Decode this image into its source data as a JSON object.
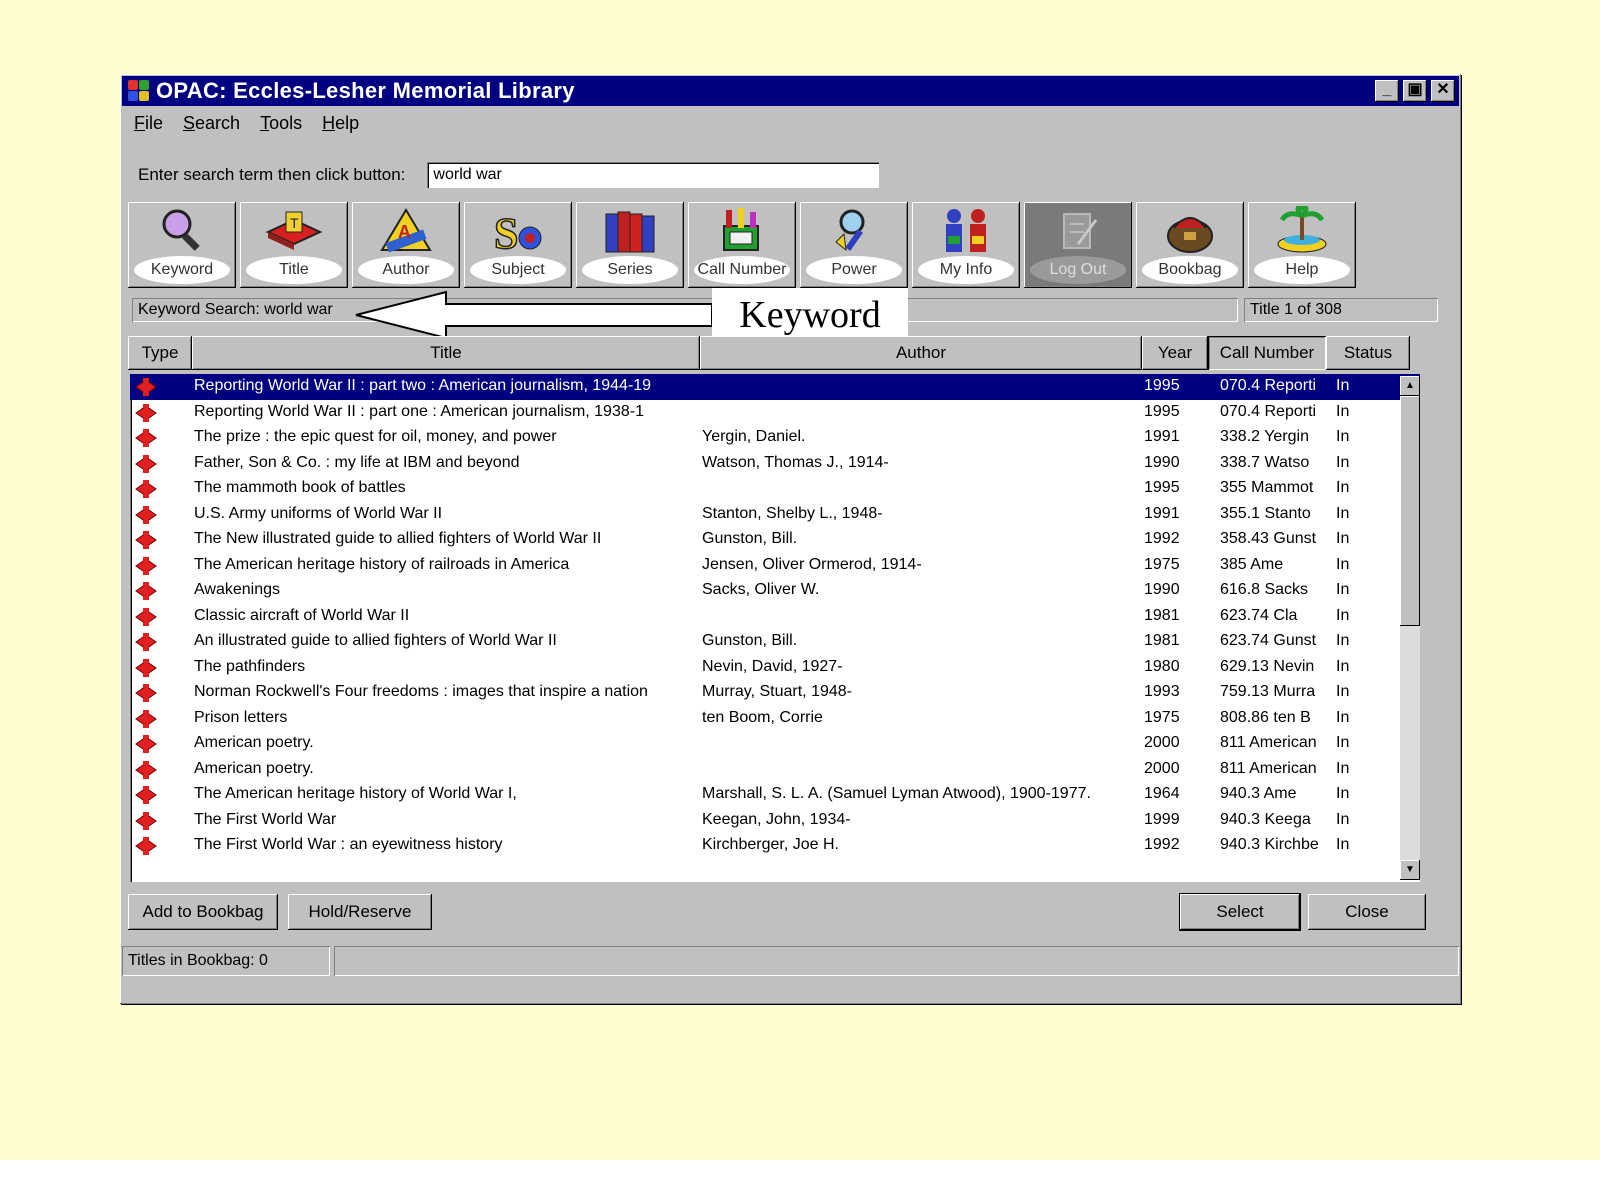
{
  "window": {
    "title": "OPAC: Eccles-Lesher Memorial Library",
    "controls": {
      "minimize": "_",
      "maximize": "▣",
      "close": "✕"
    }
  },
  "menu": [
    {
      "label": "File",
      "accel": "F",
      "rest": "ile"
    },
    {
      "label": "Search",
      "accel": "S",
      "rest": "earch"
    },
    {
      "label": "Tools",
      "accel": "T",
      "rest": "ools"
    },
    {
      "label": "Help",
      "accel": "H",
      "rest": "elp"
    }
  ],
  "search": {
    "label": "Enter search term then click button:",
    "value": "world war"
  },
  "toolbar": [
    {
      "label": "Keyword",
      "icon": "magnifier-icon"
    },
    {
      "label": "Title",
      "icon": "book-icon"
    },
    {
      "label": "Author",
      "icon": "author-icon"
    },
    {
      "label": "Subject",
      "icon": "subject-icon"
    },
    {
      "label": "Series",
      "icon": "series-books-icon"
    },
    {
      "label": "Call Number",
      "icon": "call-number-icon"
    },
    {
      "label": "Power",
      "icon": "power-search-icon"
    },
    {
      "label": "My Info",
      "icon": "people-icon"
    },
    {
      "label": "Log Out",
      "icon": "log-out-icon",
      "disabled": true
    },
    {
      "label": "Bookbag",
      "icon": "bookbag-icon"
    },
    {
      "label": "Help",
      "icon": "help-island-icon"
    }
  ],
  "status_line": "Keyword Search: world war",
  "title_count": "Title 1 of 308",
  "callout": "Keyword",
  "columns": {
    "type": "Type",
    "title": "Title",
    "author": "Author",
    "year": "Year",
    "call_number": "Call Number",
    "status": "Status"
  },
  "rows": [
    {
      "title": "Reporting World War II : part two : American journalism, 1944-19",
      "author": "",
      "year": "1995",
      "call": "070.4 Reporti",
      "status": "In",
      "selected": true
    },
    {
      "title": "Reporting World War II : part one : American journalism, 1938-1",
      "author": "",
      "year": "1995",
      "call": "070.4 Reporti",
      "status": "In"
    },
    {
      "title": "The prize : the epic quest for oil, money, and power",
      "author": "Yergin, Daniel.",
      "year": "1991",
      "call": "338.2 Yergin",
      "status": "In"
    },
    {
      "title": "Father, Son & Co. : my life at IBM and beyond",
      "author": "Watson, Thomas J., 1914-",
      "year": "1990",
      "call": "338.7 Watso",
      "status": "In"
    },
    {
      "title": "The mammoth book of battles",
      "author": "",
      "year": "1995",
      "call": "355 Mammot",
      "status": "In"
    },
    {
      "title": "U.S. Army uniforms of World War II",
      "author": "Stanton, Shelby L., 1948-",
      "year": "1991",
      "call": "355.1 Stanto",
      "status": "In"
    },
    {
      "title": "The New illustrated guide to allied fighters of World War II",
      "author": "Gunston, Bill.",
      "year": "1992",
      "call": "358.43 Gunst",
      "status": "In"
    },
    {
      "title": "The American heritage history of railroads in America",
      "author": "Jensen, Oliver Ormerod, 1914-",
      "year": "1975",
      "call": "385 Ame",
      "status": "In"
    },
    {
      "title": "Awakenings",
      "author": "Sacks, Oliver W.",
      "year": "1990",
      "call": "616.8 Sacks",
      "status": "In"
    },
    {
      "title": "Classic aircraft of World War II",
      "author": "",
      "year": "1981",
      "call": "623.74 Cla",
      "status": "In"
    },
    {
      "title": "An illustrated guide to allied fighters of World War II",
      "author": "Gunston, Bill.",
      "year": "1981",
      "call": "623.74 Gunst",
      "status": "In"
    },
    {
      "title": "The pathfinders",
      "author": "Nevin, David, 1927-",
      "year": "1980",
      "call": "629.13 Nevin",
      "status": "In"
    },
    {
      "title": "Norman Rockwell's Four freedoms : images that inspire a nation",
      "author": "Murray, Stuart, 1948-",
      "year": "1993",
      "call": "759.13 Murra",
      "status": "In"
    },
    {
      "title": "Prison letters",
      "author": "ten Boom, Corrie",
      "year": "1975",
      "call": "808.86 ten B",
      "status": "In"
    },
    {
      "title": "American poetry.",
      "author": "",
      "year": "2000",
      "call": "811 American",
      "status": "In"
    },
    {
      "title": "American poetry.",
      "author": "",
      "year": "2000",
      "call": "811 American",
      "status": "In"
    },
    {
      "title": "The American heritage history of World War I,",
      "author": "Marshall, S. L. A. (Samuel Lyman Atwood), 1900-1977.",
      "year": "1964",
      "call": "940.3 Ame",
      "status": "In"
    },
    {
      "title": "The First World War",
      "author": "Keegan, John, 1934-",
      "year": "1999",
      "call": "940.3 Keega",
      "status": "In"
    },
    {
      "title": "The First World War : an eyewitness history",
      "author": "Kirchberger, Joe H.",
      "year": "1992",
      "call": "940.3 Kirchbe",
      "status": "In"
    }
  ],
  "buttons": {
    "add_to_bookbag": "Add to Bookbag",
    "hold_reserve": "Hold/Reserve",
    "select": "Select",
    "close": "Close"
  },
  "statusbar": {
    "titles_in_bookbag": "Titles in Bookbag:  0"
  }
}
